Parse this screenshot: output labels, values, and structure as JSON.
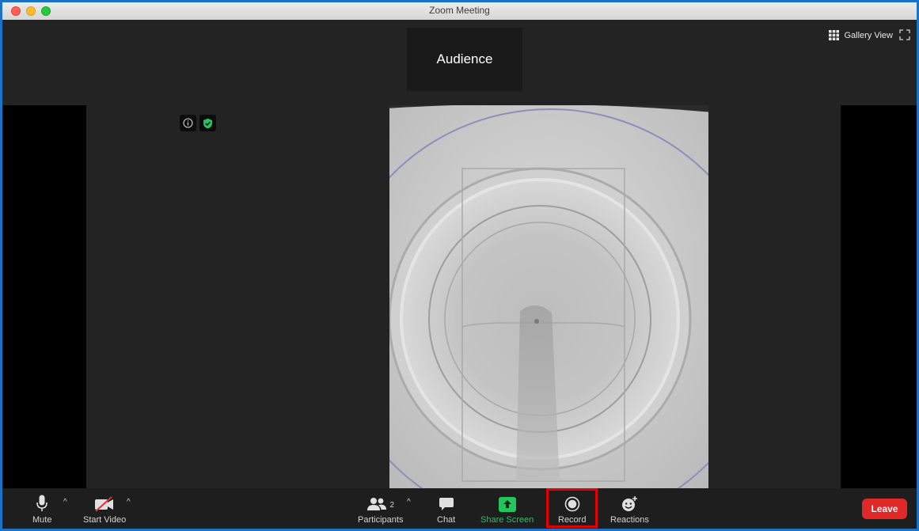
{
  "window": {
    "title": "Zoom Meeting"
  },
  "topbar": {
    "speaker_tile_label": "Audience",
    "view_toggle_label": "Gallery View"
  },
  "toolbar": {
    "mute_label": "Mute",
    "start_video_label": "Start Video",
    "participants_label": "Participants",
    "participants_count": "2",
    "chat_label": "Chat",
    "share_screen_label": "Share Screen",
    "record_label": "Record",
    "reactions_label": "Reactions",
    "leave_label": "Leave"
  },
  "colors": {
    "share_green": "#22c55e",
    "leave_red": "#e02828",
    "highlight_red": "#e00000",
    "frame_blue": "#1a73c8"
  }
}
